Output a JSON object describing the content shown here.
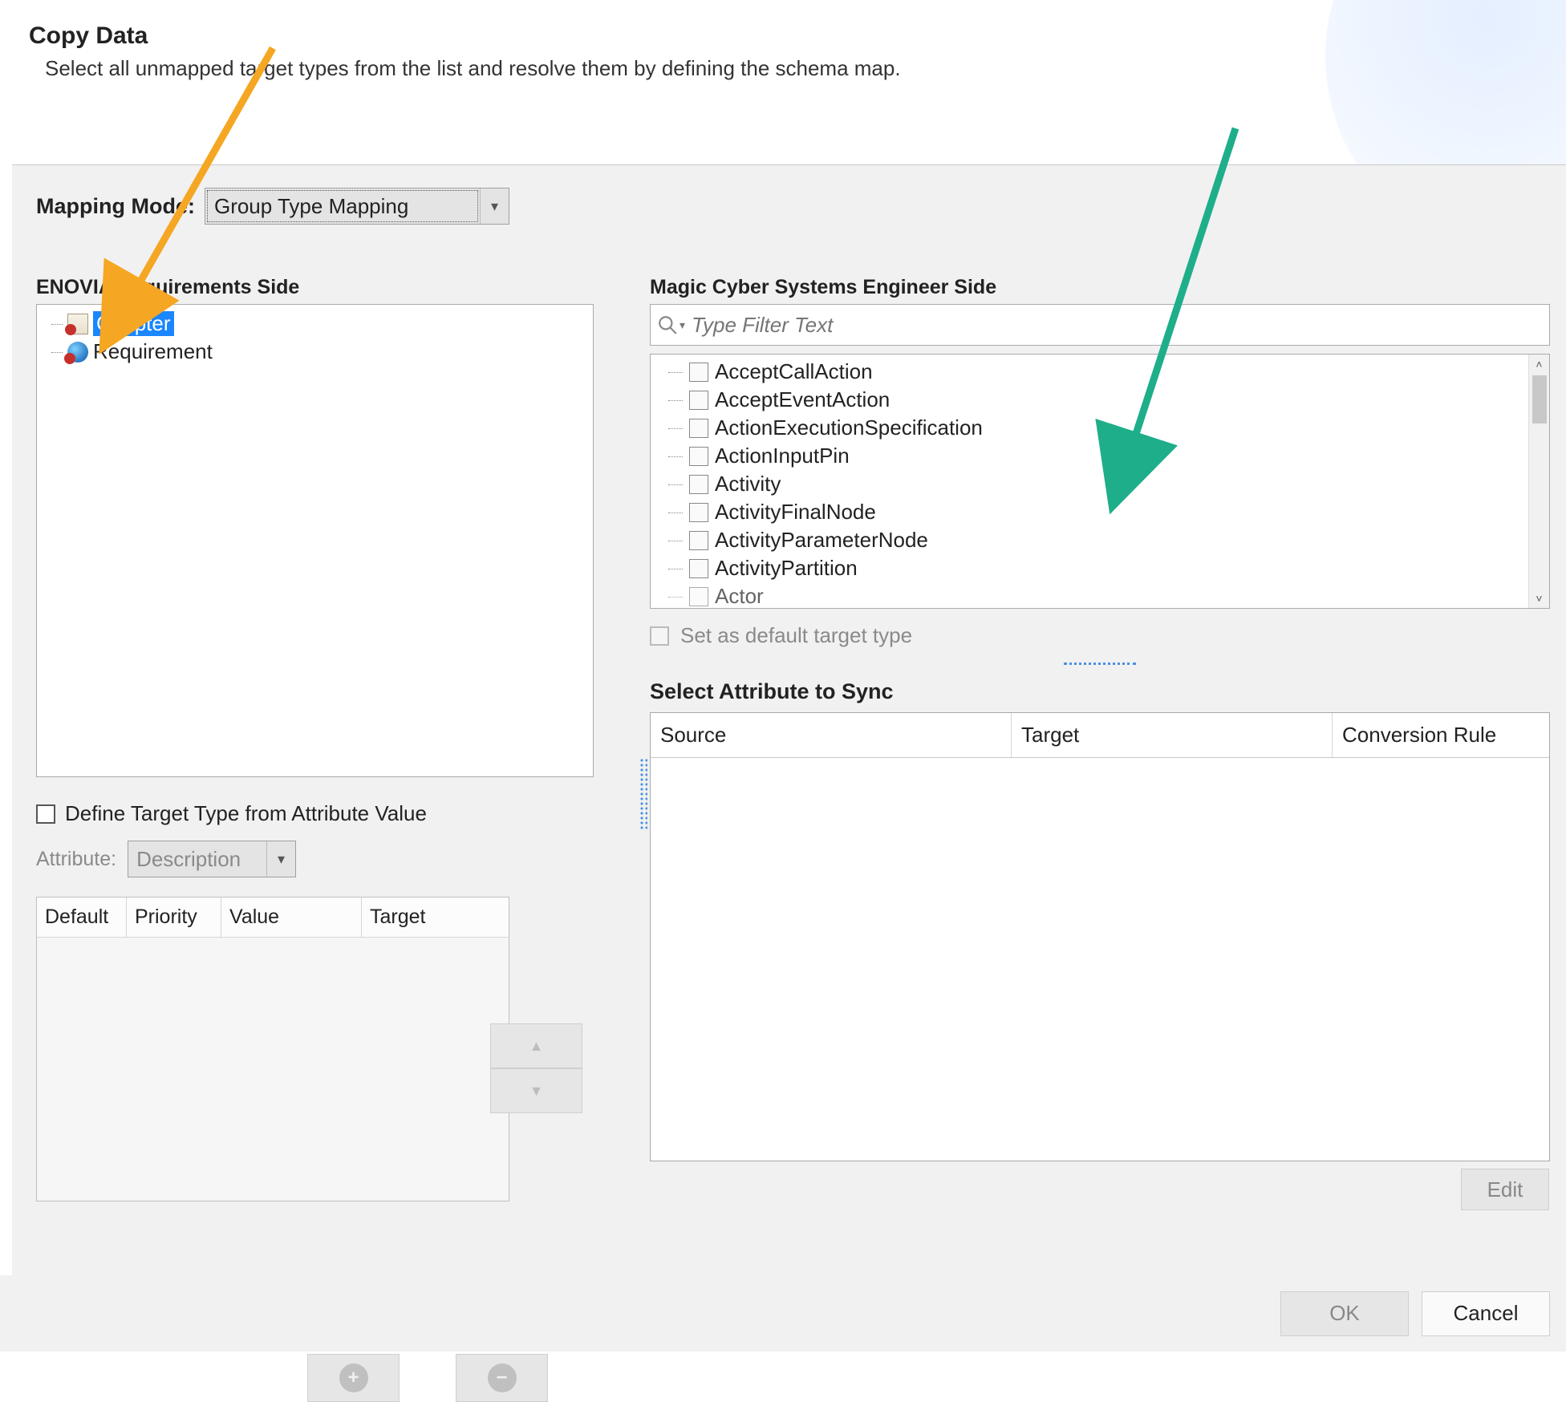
{
  "header": {
    "title": "Copy Data",
    "subtitle": "Select all unmapped target types from the list and resolve them by defining the schema map."
  },
  "mapping_mode": {
    "label": "Mapping Mode:",
    "value": "Group Type Mapping"
  },
  "left": {
    "title": "ENOVIA Requirements Side",
    "tree": [
      {
        "label": "Chapter",
        "selected": true
      },
      {
        "label": "Requirement",
        "selected": false
      }
    ],
    "define_target_label": "Define Target Type from Attribute Value",
    "attribute_label": "Attribute:",
    "attribute_value": "Description",
    "table_cols": [
      "Default",
      "Priority",
      "Value",
      "Target"
    ]
  },
  "right": {
    "title": "Magic Cyber Systems Engineer Side",
    "filter_placeholder": "Type Filter Text",
    "types": [
      "AcceptCallAction",
      "AcceptEventAction",
      "ActionExecutionSpecification",
      "ActionInputPin",
      "Activity",
      "ActivityFinalNode",
      "ActivityParameterNode",
      "ActivityPartition",
      "Actor"
    ],
    "set_default_label": "Set as default target type",
    "select_attr_title": "Select Attribute to Sync",
    "attr_cols": [
      "Source",
      "Target",
      "Conversion Rule"
    ],
    "edit_label": "Edit"
  },
  "footer": {
    "ok": "OK",
    "cancel": "Cancel"
  }
}
